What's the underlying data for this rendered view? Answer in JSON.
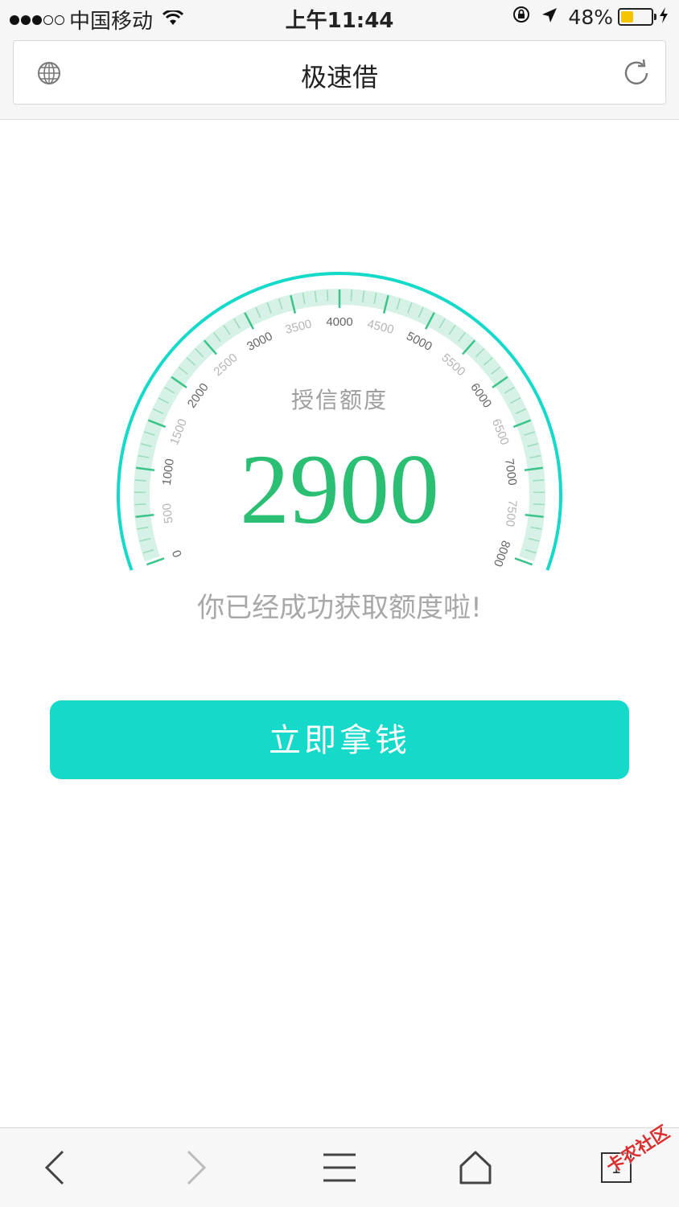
{
  "status_bar": {
    "carrier": "中国移动",
    "time": "上午11:44",
    "battery_percent": "48%",
    "battery_level": 0.48
  },
  "address_bar": {
    "title": "极速借"
  },
  "gauge": {
    "label": "授信额度",
    "value": "2900",
    "message": "你已经成功获取额度啦!",
    "min": 0,
    "max": 8000,
    "ticks": [
      "0",
      "500",
      "1000",
      "1500",
      "2000",
      "2500",
      "3000",
      "3500",
      "4000",
      "4500",
      "5000",
      "5500",
      "6000",
      "6500",
      "7000",
      "7500",
      "8000"
    ],
    "colors": {
      "outer_arc": "#15d9c9",
      "inner_band": "#d6f2e6",
      "value_text": "#2abf72",
      "tick_major": "#3cc38a"
    }
  },
  "cta": {
    "label": "立即拿钱",
    "color": "#15d9c9"
  },
  "toolbar": {
    "tab_count": "1",
    "watermark": "卡农社区"
  }
}
